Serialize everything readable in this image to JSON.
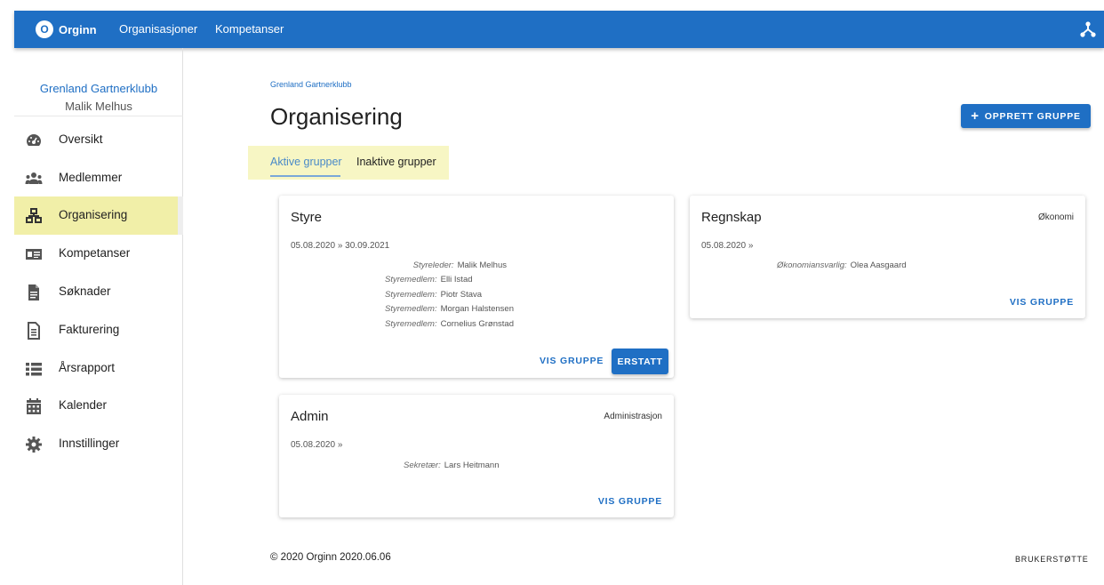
{
  "topbar": {
    "logo_mark": "O",
    "logo_text": "Orginn",
    "nav": [
      "Organisasjoner",
      "Kompetanser"
    ],
    "share_icon": "share-network-icon",
    "color": "#1f6fc4"
  },
  "sidebar": {
    "org_name": "Grenland Gartnerklubb",
    "user_name": "Malik Melhus",
    "items": [
      {
        "label": "Oversikt",
        "icon": "dashboard-icon"
      },
      {
        "label": "Medlemmer",
        "icon": "people-icon"
      },
      {
        "label": "Organisering",
        "icon": "organization-icon",
        "active": true
      },
      {
        "label": "Kompetanser",
        "icon": "id-card-icon"
      },
      {
        "label": "Søknader",
        "icon": "document-icon"
      },
      {
        "label": "Fakturering",
        "icon": "invoice-icon"
      },
      {
        "label": "Årsrapport",
        "icon": "list-icon"
      },
      {
        "label": "Kalender",
        "icon": "calendar-icon"
      },
      {
        "label": "Innstillinger",
        "icon": "gear-icon"
      }
    ]
  },
  "main": {
    "breadcrumb": "Grenland Gartnerklubb",
    "title": "Organisering",
    "create_button": "OPPRETT GRUPPE",
    "tabs": [
      "Aktive grupper",
      "Inaktive grupper"
    ],
    "active_tab": "Aktive grupper",
    "cards": {
      "styre": {
        "name": "Styre",
        "dates": "05.08.2020 » 30.09.2021",
        "roles": [
          {
            "role": "Styreleder:",
            "person": "Malik Melhus"
          },
          {
            "role": "Styremedlem:",
            "person": "Elli Istad"
          },
          {
            "role": "Styremedlem:",
            "person": "Piotr Stava"
          },
          {
            "role": "Styremedlem:",
            "person": "Morgan Halstensen"
          },
          {
            "role": "Styremedlem:",
            "person": "Cornelius Grønstad"
          }
        ],
        "view_label": "VIS GRUPPE",
        "replace_label": "ERSTATT"
      },
      "regnskap": {
        "name": "Regnskap",
        "type": "Økonomi",
        "dates": "05.08.2020 »",
        "roles": [
          {
            "role": "Økonomiansvarlig:",
            "person": "Olea Aasgaard"
          }
        ],
        "view_label": "VIS GRUPPE"
      },
      "admin": {
        "name": "Admin",
        "type": "Administrasjon",
        "dates": "05.08.2020 »",
        "roles": [
          {
            "role": "Sekretær:",
            "person": "Lars Heitmann"
          }
        ],
        "view_label": "VIS GRUPPE"
      }
    }
  },
  "footer": {
    "copyright": "© 2020 Orginn 2020.06.06",
    "support": "BRUKERSTØTTE"
  },
  "colors": {
    "primary": "#1f6fc4",
    "highlight": "#f1efa8",
    "tab_highlight": "#f7f6c4"
  }
}
